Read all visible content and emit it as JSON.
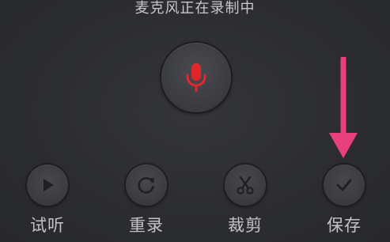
{
  "status": {
    "text": "麦克风正在录制中"
  },
  "record_button": {
    "icon": "microphone-icon",
    "icon_color": "#e2262b"
  },
  "annotation": {
    "icon": "pink-down-arrow",
    "color": "#e8407a"
  },
  "actions": [
    {
      "label": "试听",
      "icon": "play-icon"
    },
    {
      "label": "重录",
      "icon": "refresh-icon"
    },
    {
      "label": "裁剪",
      "icon": "scissors-icon"
    },
    {
      "label": "保存",
      "icon": "check-icon"
    }
  ],
  "colors": {
    "background": "#2b2c30",
    "button": "#3c3d42",
    "icon": "#1f2023",
    "text": "#c4c4c4"
  }
}
